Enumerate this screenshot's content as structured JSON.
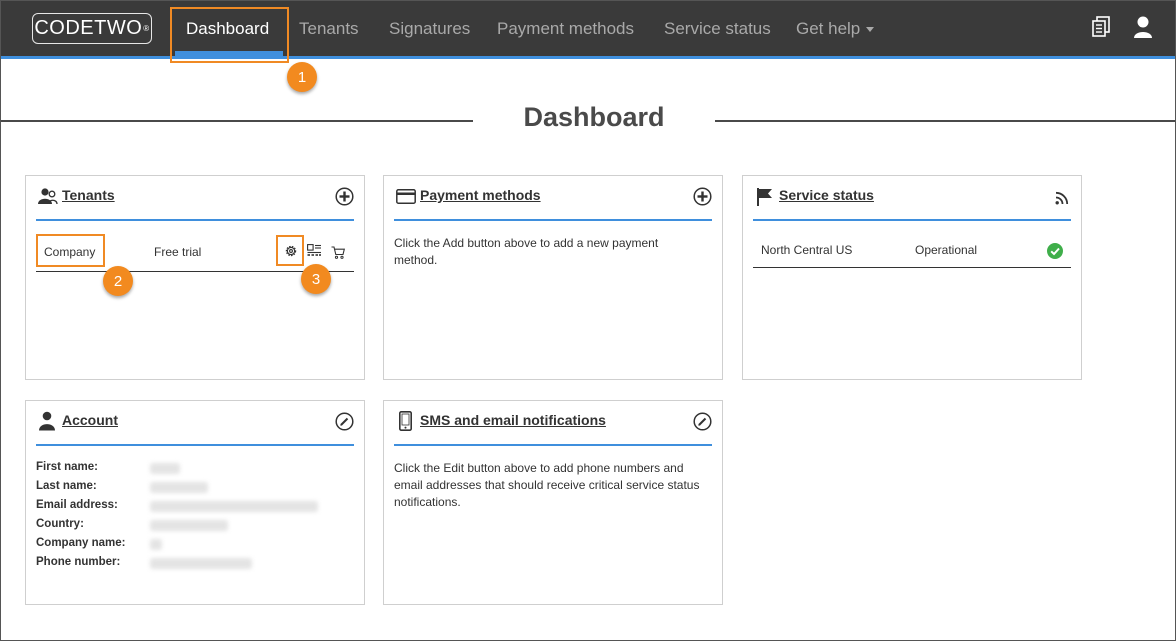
{
  "brand": {
    "logo_main": "CODE",
    "logo_thin": "TWO",
    "logo_mark": "®"
  },
  "nav": {
    "items": [
      {
        "label": "Dashboard",
        "active": true
      },
      {
        "label": "Tenants"
      },
      {
        "label": "Signatures"
      },
      {
        "label": "Payment methods"
      },
      {
        "label": "Service status"
      },
      {
        "label": "Get help"
      }
    ],
    "right_icons": [
      "documents-icon",
      "user-icon"
    ]
  },
  "page": {
    "title": "Dashboard"
  },
  "callouts": [
    "1",
    "2",
    "3"
  ],
  "tenants": {
    "title": "Tenants",
    "rows": [
      {
        "name": "Company",
        "plan": "Free trial"
      }
    ]
  },
  "payment": {
    "title": "Payment methods",
    "message": "Click the Add button above to add a new payment method."
  },
  "service": {
    "title": "Service status",
    "rows": [
      {
        "region": "North Central US",
        "status": "Operational"
      }
    ]
  },
  "account": {
    "title": "Account",
    "fields": [
      {
        "label": "First name:"
      },
      {
        "label": "Last name:"
      },
      {
        "label": "Email address:"
      },
      {
        "label": "Country:"
      },
      {
        "label": "Company name:"
      },
      {
        "label": "Phone number:"
      }
    ]
  },
  "sms": {
    "title": "SMS and email notifications",
    "message": "Click the Edit button above to add phone numbers and email addresses that should receive critical service status notifications."
  },
  "colors": {
    "accent": "#3f8fdd",
    "callout": "#f28a1f",
    "topbar": "#3a3a3a",
    "ok": "#3fae4a"
  }
}
